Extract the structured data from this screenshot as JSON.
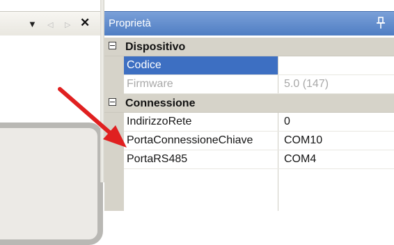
{
  "left_pane": {
    "toolbar": {
      "dropdown_glyph": "▼",
      "nav_left_glyph": "◁",
      "nav_right_glyph": "▷",
      "close_glyph": "✕"
    }
  },
  "properties": {
    "title": "Proprietà",
    "pin_icon": "pin-icon",
    "categories": [
      {
        "label": "Dispositivo",
        "rows": [
          {
            "name": "Codice",
            "value": "",
            "state": "selected"
          },
          {
            "name": "Firmware",
            "value": "5.0 (147)",
            "state": "disabled"
          }
        ]
      },
      {
        "label": "Connessione",
        "rows": [
          {
            "name": "IndirizzoRete",
            "value": "0",
            "state": "normal"
          },
          {
            "name": "PortaConnessioneChiave",
            "value": "COM10",
            "state": "normal"
          },
          {
            "name": "PortaRS485",
            "value": "COM4",
            "state": "normal"
          }
        ]
      }
    ]
  },
  "colors": {
    "titlebar": "#5b88cb",
    "selection": "#3d6fc2",
    "arrow": "#e02020",
    "category_bg": "#d6d3c9"
  }
}
